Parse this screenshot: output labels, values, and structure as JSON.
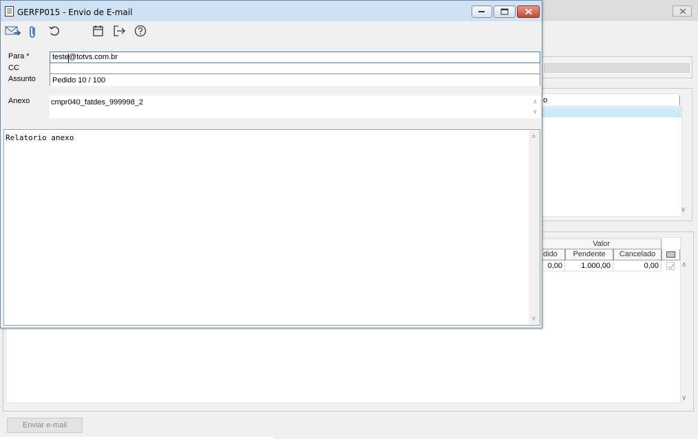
{
  "dialog": {
    "title": "GERFP015 - Envio de E-mail",
    "fields": {
      "para_label": "Para *",
      "para_value": "teste@totvs.com.br",
      "cc_label": "CC",
      "cc_value": "",
      "assunto_label": "Assunto",
      "assunto_value": "Pedido 10 / 100",
      "anexo_label": "Anexo",
      "anexo_value": "cmpr040_fatdes_999998_2"
    },
    "body": "Relatorio anexo",
    "toolbar_icons": [
      "send-email-icon",
      "attach-clip-icon",
      "undo-icon",
      "calendar-icon",
      "exit-icon",
      "help-icon"
    ]
  },
  "background": {
    "list_header": "o",
    "grid": {
      "group_header": "Valor",
      "columns": [
        "dido",
        "Pendente",
        "Cancelado"
      ],
      "row": {
        "pedido": "0,00",
        "pendente": "1.000,00",
        "cancelado": "0,00",
        "checked": true
      }
    },
    "send_button": "Enviar e-mail"
  },
  "colors": {
    "title_bar": "#cfe1f2",
    "close_button": "#c24a32",
    "selection": "#cdeaf8",
    "focus_border": "#3c7fb1"
  }
}
